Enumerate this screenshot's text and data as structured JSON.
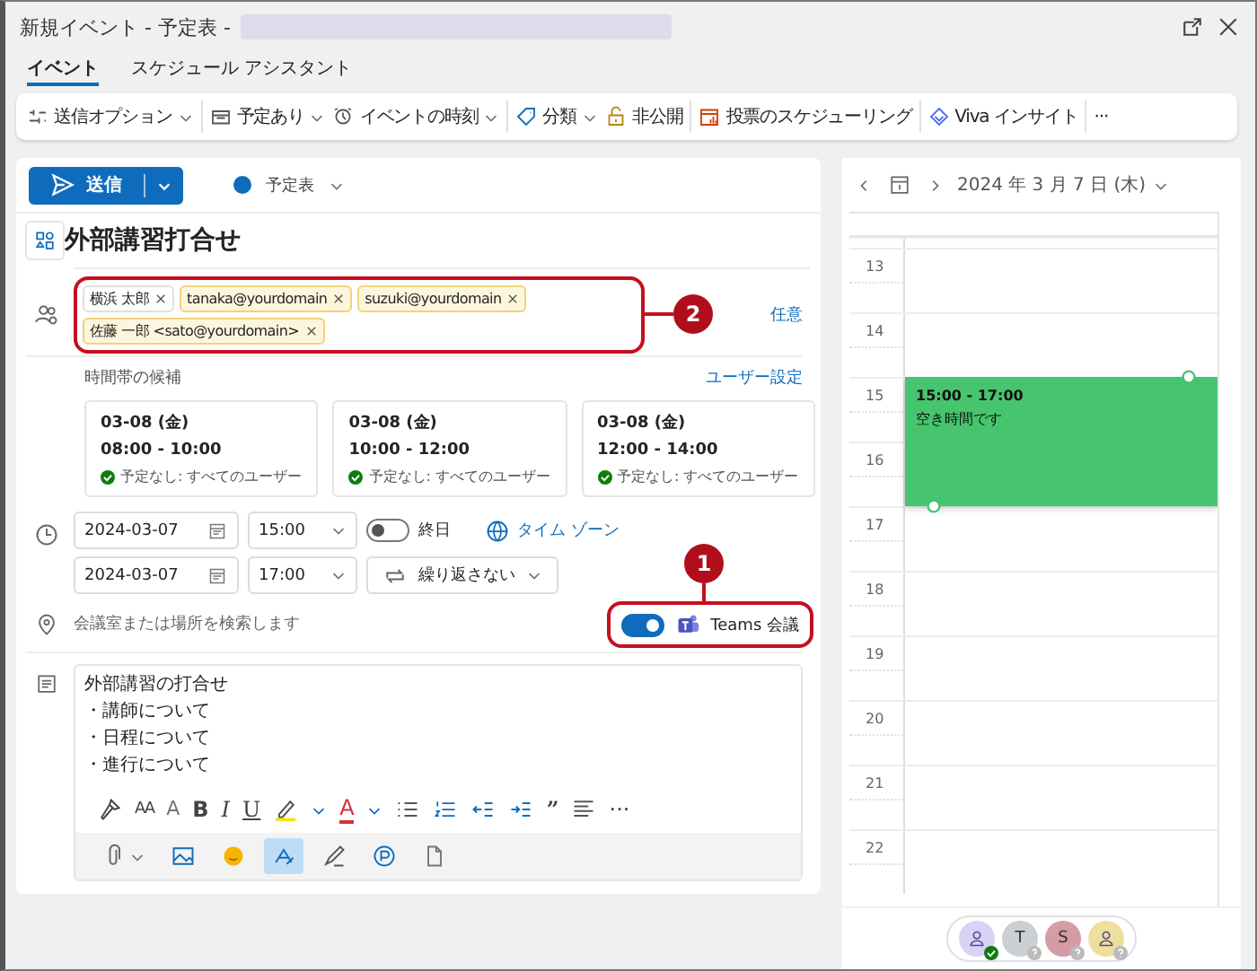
{
  "window": {
    "title": "新規イベント - 予定表 -"
  },
  "tabs": [
    {
      "label": "イベント",
      "selected": true
    },
    {
      "label": "スケジュール アシスタント",
      "selected": false
    }
  ],
  "toolbar": [
    [
      {
        "label": "送信オプション",
        "dropdown": true
      }
    ],
    [
      {
        "label": "予定あり",
        "dropdown": true
      },
      {
        "label": "イベントの時刻",
        "dropdown": true
      }
    ],
    [
      {
        "label": "分類",
        "dropdown": true
      },
      {
        "label": "非公開",
        "dropdown": false
      }
    ],
    [
      {
        "label": "投票のスケジューリング",
        "dropdown": false
      }
    ],
    [
      {
        "label": "Viva インサイト",
        "dropdown": false
      }
    ],
    [
      {
        "label": "···",
        "dropdown": false
      }
    ]
  ],
  "send_button": {
    "label": "送信"
  },
  "calendar": {
    "label": "予定表"
  },
  "title": "外部講習打合せ",
  "attendees": [
    {
      "label": "横浜 太郎",
      "resolved": true
    },
    {
      "label": "tanaka@yourdomain",
      "resolved": false
    },
    {
      "label": "suzuki@yourdomain",
      "resolved": false
    },
    {
      "label": "佐藤 一郎 <sato@yourdomain>",
      "resolved": false
    }
  ],
  "attendees_callout": "2",
  "optional_link": "任意",
  "suggestions": {
    "label": "時間帯の候補",
    "settings_link": "ユーザー設定",
    "slots": [
      {
        "date": "03-08 (金)",
        "time": "08:00 - 10:00",
        "status": "予定なし: すべてのユーザー"
      },
      {
        "date": "03-08 (金)",
        "time": "10:00 - 12:00",
        "status": "予定なし: すべてのユーザー"
      },
      {
        "date": "03-08 (金)",
        "time": "12:00 - 14:00",
        "status": "予定なし: すべてのユーザー"
      }
    ]
  },
  "start": {
    "date": "2024-03-07",
    "time": "15:00"
  },
  "end": {
    "date": "2024-03-07",
    "time": "17:00"
  },
  "all_day": {
    "label": "終日",
    "on": false
  },
  "timezone_link": "タイム ゾーン",
  "repeat": "繰り返さない",
  "location": {
    "placeholder": "会議室または場所を検索します"
  },
  "teams": {
    "label": "Teams 会議",
    "on": true,
    "callout": "1"
  },
  "body": [
    "外部講習の打合せ",
    "・講師について",
    "・日程について",
    "・進行について"
  ],
  "format_toolbar": {
    "font_size": "AA",
    "grow_font": "A",
    "bold": "B",
    "italic": "I",
    "underline": "U",
    "font_color": "A",
    "quote": "”",
    "more": "···"
  },
  "insert_toolbar": [
    {
      "selected": false
    },
    {
      "selected": false
    },
    {
      "selected": false
    },
    {
      "selected": true
    },
    {
      "selected": false
    },
    {
      "selected": false
    },
    {
      "selected": false
    }
  ],
  "day_view": {
    "date": "2024 年 3 月 7 日 (木)",
    "hours": [
      {
        "label": "13"
      },
      {
        "label": "14"
      },
      {
        "label": "15",
        "event": {
          "time": "15:00 - 17:00",
          "note": "空き時間です"
        }
      },
      {
        "label": "16"
      },
      {
        "label": "17"
      },
      {
        "label": "18"
      },
      {
        "label": "19"
      },
      {
        "label": "20"
      },
      {
        "label": "21"
      },
      {
        "label": "22"
      }
    ]
  },
  "avatars": [
    {
      "kind": "person",
      "color": "#d9d2f5",
      "accepted": true
    },
    {
      "kind": "initial",
      "initial": "T",
      "color": "#c9cfd3",
      "accepted": false
    },
    {
      "kind": "initial",
      "initial": "S",
      "color": "#d69ca5",
      "accepted": false
    },
    {
      "kind": "person",
      "color": "#efdf9c",
      "accepted": false
    }
  ]
}
